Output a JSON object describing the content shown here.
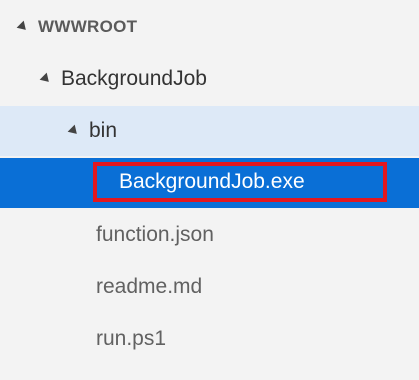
{
  "explorer": {
    "root": {
      "label": "WWWROOT",
      "expanded": true,
      "twisty_icon": "chevron-expanded-icon"
    },
    "items": [
      {
        "label": "BackgroundJob",
        "kind": "folder",
        "expanded": true,
        "depth": 1
      },
      {
        "label": "bin",
        "kind": "folder",
        "expanded": true,
        "depth": 2
      },
      {
        "label": "BackgroundJob.exe",
        "kind": "file",
        "selected": true,
        "highlighted": true,
        "depth": 3
      },
      {
        "label": "function.json",
        "kind": "file",
        "depth": 2
      },
      {
        "label": "readme.md",
        "kind": "file",
        "depth": 2
      },
      {
        "label": "run.ps1",
        "kind": "file",
        "depth": 2
      }
    ]
  },
  "colors": {
    "background": "#f3f3f3",
    "folder_hover": "#dde9f7",
    "selection": "#0a6fd6",
    "annotation_outline": "#e2171f"
  }
}
